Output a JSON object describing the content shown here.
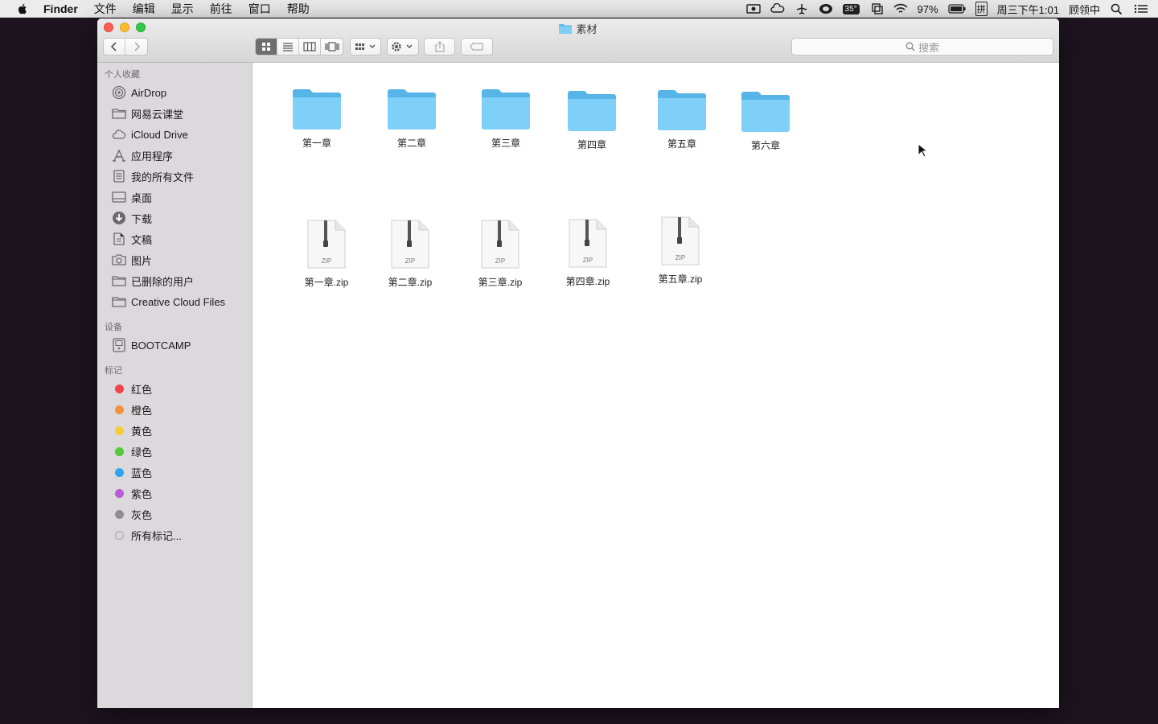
{
  "menubar": {
    "app_name": "Finder",
    "menus": [
      "文件",
      "编辑",
      "显示",
      "前往",
      "窗口",
      "帮助"
    ],
    "temperature": "35°",
    "battery": "97%",
    "input_method": "拼",
    "clock": "周三下午1:01",
    "user": "顾领中"
  },
  "window": {
    "title": "素材",
    "search_placeholder": "搜索"
  },
  "sidebar": {
    "favorites_title": "个人收藏",
    "favorites": [
      {
        "label": "AirDrop",
        "icon": "airdrop-icon"
      },
      {
        "label": "网易云课堂",
        "icon": "folder-icon"
      },
      {
        "label": "iCloud Drive",
        "icon": "cloud-icon"
      },
      {
        "label": "应用程序",
        "icon": "applications-icon"
      },
      {
        "label": "我的所有文件",
        "icon": "all-files-icon"
      },
      {
        "label": "桌面",
        "icon": "desktop-icon"
      },
      {
        "label": "下载",
        "icon": "download-icon"
      },
      {
        "label": "文稿",
        "icon": "documents-icon"
      },
      {
        "label": "图片",
        "icon": "camera-icon"
      },
      {
        "label": "已删除的用户",
        "icon": "folder-icon"
      },
      {
        "label": "Creative Cloud Files",
        "icon": "folder-icon"
      }
    ],
    "devices_title": "设备",
    "devices": [
      {
        "label": "BOOTCAMP",
        "icon": "disk-icon"
      }
    ],
    "tags_title": "标记",
    "tags": [
      {
        "label": "红色",
        "color": "#f0434b"
      },
      {
        "label": "橙色",
        "color": "#f5913b"
      },
      {
        "label": "黄色",
        "color": "#f5cc38"
      },
      {
        "label": "绿色",
        "color": "#52c83c"
      },
      {
        "label": "蓝色",
        "color": "#2ea4f0"
      },
      {
        "label": "紫色",
        "color": "#bd5ad7"
      },
      {
        "label": "灰色",
        "color": "#8e8e93"
      },
      {
        "label": "所有标记...",
        "color": "#c8c8c8"
      }
    ]
  },
  "files": {
    "folders": [
      "第一章",
      "第二章",
      "第三章",
      "第四章",
      "第五章",
      "第六章"
    ],
    "zips": [
      "第一章.zip",
      "第二章.zip",
      "第三章.zip",
      "第四章.zip",
      "第五章.zip"
    ],
    "zip_badge": "ZIP"
  }
}
